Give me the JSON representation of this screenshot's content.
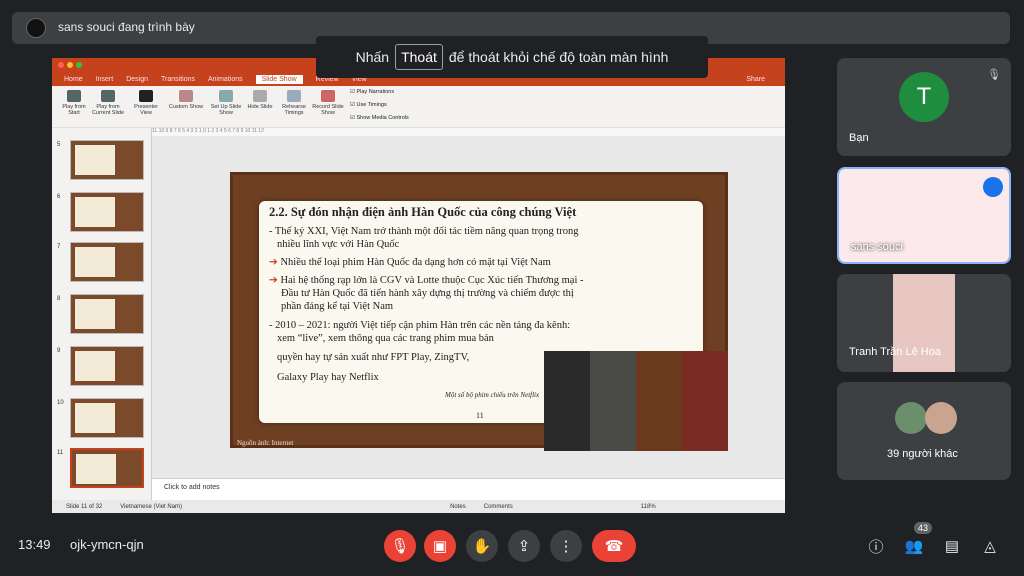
{
  "meet": {
    "presenter_text": "sans souci đang trình bày",
    "toast": {
      "before": "Nhấn",
      "key": "Thoát",
      "after": "để thoát khỏi chế độ toàn màn hình"
    },
    "time": "13:49",
    "meeting_code": "ojk-ymcn-qjn",
    "participant_count": "43",
    "tiles": {
      "self": {
        "initial": "T",
        "name": "Bạn",
        "avatar_color": "#1e8e3e"
      },
      "sans": {
        "name": "sans souci"
      },
      "hoa": {
        "name": "Tranh Trần Lê Hoa"
      },
      "others": {
        "name": "39 người khác"
      }
    },
    "controls": [
      "mic-off-icon",
      "camera-off-icon",
      "raise-hand-icon",
      "present-icon",
      "more-icon",
      "end-call-icon"
    ],
    "right_icons": [
      "info-icon",
      "people-icon",
      "chat-icon",
      "activities-icon"
    ]
  },
  "ppt": {
    "tabs": [
      "Home",
      "Insert",
      "Design",
      "Transitions",
      "Animations",
      "Slide Show",
      "Review",
      "View"
    ],
    "active_tab": "Slide Show",
    "share": "Share",
    "ribbon": [
      {
        "label": "Play from Start"
      },
      {
        "label": "Play from Current Slide"
      },
      {
        "label": "Presenter View"
      },
      {
        "label": "Custom Show"
      },
      {
        "label": "Set Up Slide Show"
      },
      {
        "label": "Hide Slide"
      },
      {
        "label": "Rehearse Timings"
      },
      {
        "label": "Record Slide Show"
      }
    ],
    "checkboxes": [
      "Play Narrations",
      "Use Timings",
      "Show Media Controls"
    ],
    "ruler": "11 10 9 8 7 6 5 4 3 2 1 0 1 2 3 4 5 6 7 8 9 10 11 12",
    "thumb_numbers": [
      "5",
      "6",
      "7",
      "8",
      "9",
      "10",
      "11"
    ],
    "notes_placeholder": "Click to add notes",
    "status": {
      "slide": "Slide 11 of 32",
      "language": "Vietnamese (Viet Nam)",
      "notes": "Notes",
      "comments": "Comments",
      "zoom": "118%"
    },
    "slide": {
      "title": "2.2. Sự đón nhận điện ảnh Hàn Quốc của công chúng Việt",
      "lines": [
        "- Thế kỷ XXI, Việt Nam trở thành một đối tác tiềm năng quan trọng trong",
        "  nhiều lĩnh vực với Hàn Quốc",
        "Nhiều thể loại phim Hàn Quốc đa dạng hơn có mặt tại Việt Nam",
        "Hai hệ thống rạp lớn là CGV và Lotte thuộc Cục Xúc tiến Thương mại -",
        "Đầu tư Hàn Quốc đã tiến hành xây dựng thị trường và chiếm được thị",
        "phần đáng kể tại Việt Nam",
        "- 2010 – 2021: người Việt tiếp cận phim Hàn trên các nền tảng đa kênh:",
        "  xem “live”, xem thông qua các trang phim mua bản",
        "  quyền hay tự sản xuất như FPT Play, ZingTV,",
        "  Galaxy Play hay Netflix"
      ],
      "caption": "Một số bộ phim chiếu trên Netflix",
      "source": "Nguồn ảnh: Internet",
      "page": "11"
    }
  }
}
